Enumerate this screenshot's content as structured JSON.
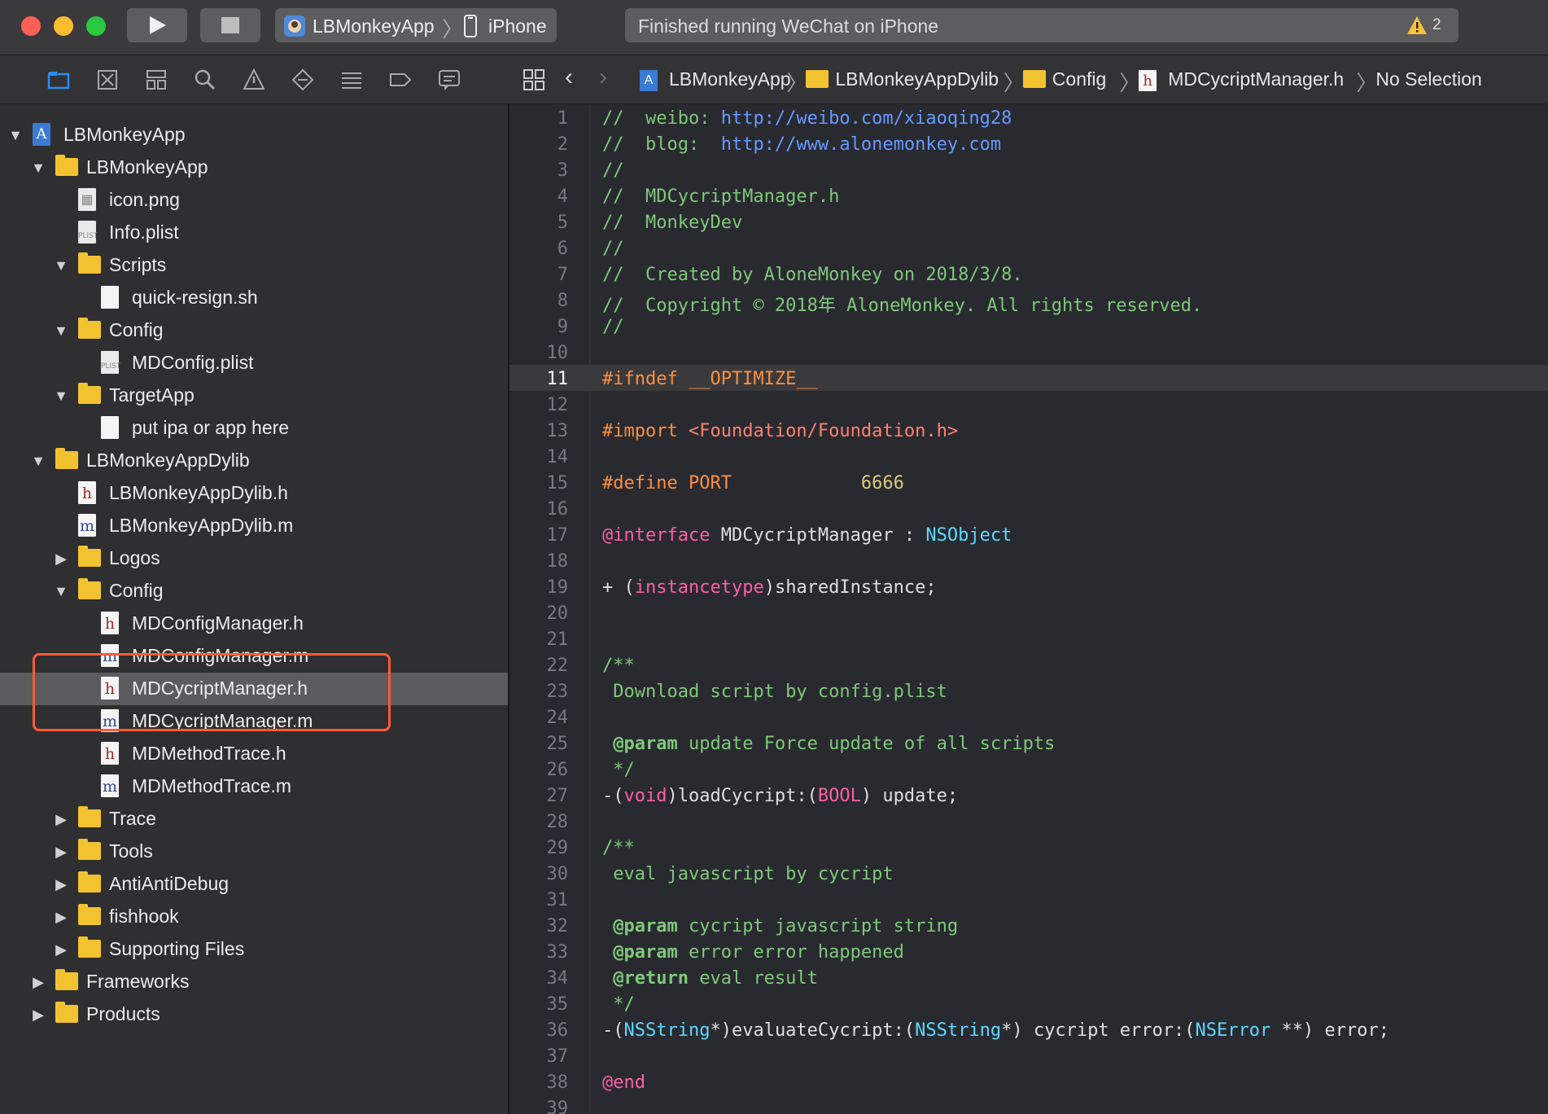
{
  "toolbar": {
    "scheme_app": "LBMonkeyApp",
    "scheme_device": "iPhone",
    "status_text": "Finished running WeChat on iPhone",
    "warning_count": "2",
    "colors": {
      "close": "#fe5f57",
      "minimize": "#febc2e",
      "zoom": "#28c840"
    }
  },
  "navigator_icons": [
    "folder-icon",
    "source-control-icon",
    "symbol-icon",
    "search-icon",
    "warning-icon",
    "test-icon",
    "debug-icon",
    "breakpoint-icon",
    "report-icon"
  ],
  "tree": [
    {
      "label": "LBMonkeyApp",
      "type": "project",
      "indent": 0,
      "disclosure": "open"
    },
    {
      "label": "LBMonkeyApp",
      "type": "folder",
      "indent": 1,
      "disclosure": "open"
    },
    {
      "label": "icon.png",
      "type": "image",
      "indent": 2,
      "disclosure": "none"
    },
    {
      "label": "Info.plist",
      "type": "plist",
      "indent": 2,
      "disclosure": "none"
    },
    {
      "label": "Scripts",
      "type": "folder",
      "indent": 2,
      "disclosure": "open"
    },
    {
      "label": "quick-resign.sh",
      "type": "file",
      "indent": 3,
      "disclosure": "none"
    },
    {
      "label": "Config",
      "type": "folder",
      "indent": 2,
      "disclosure": "open"
    },
    {
      "label": "MDConfig.plist",
      "type": "plist",
      "indent": 3,
      "disclosure": "none"
    },
    {
      "label": "TargetApp",
      "type": "folder",
      "indent": 2,
      "disclosure": "open"
    },
    {
      "label": "put ipa or app here",
      "type": "file",
      "indent": 3,
      "disclosure": "none"
    },
    {
      "label": "LBMonkeyAppDylib",
      "type": "folder",
      "indent": 1,
      "disclosure": "open"
    },
    {
      "label": "LBMonkeyAppDylib.h",
      "type": "h",
      "indent": 2,
      "disclosure": "none"
    },
    {
      "label": "LBMonkeyAppDylib.m",
      "type": "m",
      "indent": 2,
      "disclosure": "none"
    },
    {
      "label": "Logos",
      "type": "folder",
      "indent": 2,
      "disclosure": "closed"
    },
    {
      "label": "Config",
      "type": "folder",
      "indent": 2,
      "disclosure": "open"
    },
    {
      "label": "MDConfigManager.h",
      "type": "h",
      "indent": 3,
      "disclosure": "none"
    },
    {
      "label": "MDConfigManager.m",
      "type": "m",
      "indent": 3,
      "disclosure": "none"
    },
    {
      "label": "MDCycriptManager.h",
      "type": "h",
      "indent": 3,
      "disclosure": "none",
      "selected": true
    },
    {
      "label": "MDCycriptManager.m",
      "type": "m",
      "indent": 3,
      "disclosure": "none"
    },
    {
      "label": "MDMethodTrace.h",
      "type": "h",
      "indent": 3,
      "disclosure": "none"
    },
    {
      "label": "MDMethodTrace.m",
      "type": "m",
      "indent": 3,
      "disclosure": "none"
    },
    {
      "label": "Trace",
      "type": "folder",
      "indent": 2,
      "disclosure": "closed"
    },
    {
      "label": "Tools",
      "type": "folder",
      "indent": 2,
      "disclosure": "closed"
    },
    {
      "label": "AntiAntiDebug",
      "type": "folder",
      "indent": 2,
      "disclosure": "closed"
    },
    {
      "label": "fishhook",
      "type": "folder",
      "indent": 2,
      "disclosure": "closed"
    },
    {
      "label": "Supporting Files",
      "type": "folder",
      "indent": 2,
      "disclosure": "closed"
    },
    {
      "label": "Frameworks",
      "type": "folder",
      "indent": 1,
      "disclosure": "closed"
    },
    {
      "label": "Products",
      "type": "folder",
      "indent": 1,
      "disclosure": "closed"
    }
  ],
  "jumpbar": {
    "crumbs": [
      {
        "label": "LBMonkeyApp",
        "icon": "project"
      },
      {
        "label": "LBMonkeyAppDylib",
        "icon": "folder"
      },
      {
        "label": "Config",
        "icon": "folder"
      },
      {
        "label": "MDCycriptManager.h",
        "icon": "h"
      },
      {
        "label": "No Selection",
        "icon": "none"
      }
    ]
  },
  "editor": {
    "current_line": 11,
    "last_visible_line": 39,
    "lines": [
      [
        [
          "cm",
          "//  weibo: "
        ],
        [
          "url",
          "http://weibo.com/xiaoqing28"
        ]
      ],
      [
        [
          "cm",
          "//  blog:  "
        ],
        [
          "url",
          "http://www.alonemonkey.com"
        ]
      ],
      [
        [
          "cm",
          "//"
        ]
      ],
      [
        [
          "cm",
          "//  MDCycriptManager.h"
        ]
      ],
      [
        [
          "cm",
          "//  MonkeyDev"
        ]
      ],
      [
        [
          "cm",
          "//"
        ]
      ],
      [
        [
          "cm",
          "//  Created by AloneMonkey on 2018/3/8."
        ]
      ],
      [
        [
          "cm",
          "//  Copyright © 2018年 AloneMonkey. All rights reserved."
        ]
      ],
      [
        [
          "cm",
          "//"
        ]
      ],
      [],
      [
        [
          "pp",
          "#ifndef __OPTIMIZE__"
        ]
      ],
      [],
      [
        [
          "pp",
          "#import "
        ],
        [
          "str",
          "<Foundation/Foundation.h>"
        ]
      ],
      [],
      [
        [
          "pp",
          "#define PORT            "
        ],
        [
          "num",
          "6666"
        ]
      ],
      [],
      [
        [
          "kw",
          "@interface"
        ],
        [
          "ident",
          " MDCycriptManager : "
        ],
        [
          "ty",
          "NSObject"
        ]
      ],
      [],
      [
        [
          "ident",
          "+ ("
        ],
        [
          "kw",
          "instancetype"
        ],
        [
          "ident",
          ")sharedInstance;"
        ]
      ],
      [],
      [],
      [
        [
          "cm",
          "/**"
        ]
      ],
      [
        [
          "cm",
          " Download script by config.plist"
        ]
      ],
      [],
      [
        [
          "doctag",
          " @param"
        ],
        [
          "cm",
          " update Force update of all scripts"
        ]
      ],
      [
        [
          "cm",
          " */"
        ]
      ],
      [
        [
          "ident",
          "-("
        ],
        [
          "kw",
          "void"
        ],
        [
          "ident",
          ")loadCycript:("
        ],
        [
          "kw",
          "BOOL"
        ],
        [
          "ident",
          ") update;"
        ]
      ],
      [],
      [
        [
          "cm",
          "/**"
        ]
      ],
      [
        [
          "cm",
          " eval javascript by cycript"
        ]
      ],
      [],
      [
        [
          "doctag",
          " @param"
        ],
        [
          "cm",
          " cycript javascript string"
        ]
      ],
      [
        [
          "doctag",
          " @param"
        ],
        [
          "cm",
          " error error happened"
        ]
      ],
      [
        [
          "doctag",
          " @return"
        ],
        [
          "cm",
          " eval result"
        ]
      ],
      [
        [
          "cm",
          " */"
        ]
      ],
      [
        [
          "ident",
          "-("
        ],
        [
          "ty",
          "NSString"
        ],
        [
          "ident",
          "*)evaluateCycript:("
        ],
        [
          "ty",
          "NSString"
        ],
        [
          "ident",
          "*) cycript error:("
        ],
        [
          "ty",
          "NSError"
        ],
        [
          "ident",
          " **) error;"
        ]
      ],
      [],
      [
        [
          "kw",
          "@end"
        ]
      ],
      []
    ]
  }
}
